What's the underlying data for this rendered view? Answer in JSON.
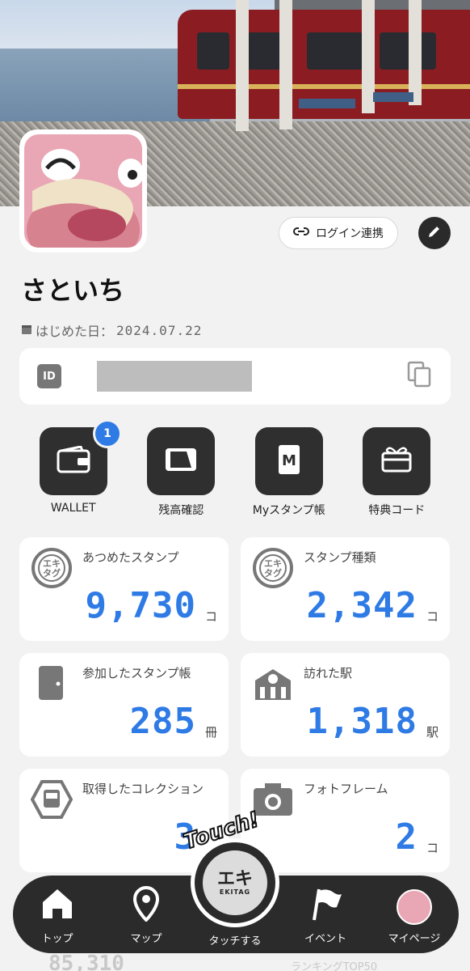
{
  "profile": {
    "name": "さといち",
    "start_date_label": "はじめた日：",
    "start_date": "2024.07.22",
    "id_badge": "ID",
    "login_link_label": "ログイン連携"
  },
  "quick_actions": [
    {
      "label": "WALLET",
      "badge": "1",
      "icon": "wallet-icon"
    },
    {
      "label": "残高確認",
      "icon": "card-icon"
    },
    {
      "label": "Myスタンプ帳",
      "icon": "stamp-book-icon"
    },
    {
      "label": "特典コード",
      "icon": "gift-icon"
    }
  ],
  "stats": [
    {
      "label": "あつめたスタンプ",
      "value": "9,730",
      "unit": "コ",
      "icon": "ekitag-stamp-icon"
    },
    {
      "label": "スタンプ種類",
      "value": "2,342",
      "unit": "コ",
      "icon": "ekitag-stamp-icon"
    },
    {
      "label": "参加したスタンプ帳",
      "value": "285",
      "unit": "冊",
      "icon": "book-icon"
    },
    {
      "label": "訪れた駅",
      "value": "1,318",
      "unit": "駅",
      "icon": "station-icon"
    },
    {
      "label": "取得したコレクション",
      "value": "3",
      "unit": "",
      "icon": "train-hexagon-icon"
    },
    {
      "label": "フォトフレーム",
      "value": "2",
      "unit": "コ",
      "icon": "camera-icon"
    }
  ],
  "peek": {
    "value": "85,310",
    "label": "ランキングTOP50"
  },
  "nav": {
    "items": [
      {
        "label": "トップ",
        "icon": "home-icon"
      },
      {
        "label": "マップ",
        "icon": "map-pin-icon"
      },
      {
        "label": "タッチする",
        "icon": "ekitag-touch-icon"
      },
      {
        "label": "イベント",
        "icon": "flag-icon"
      },
      {
        "label": "マイページ",
        "icon": "avatar-icon"
      }
    ],
    "touch_word": "Touch!",
    "center_logo_top": "エキ",
    "center_logo_bottom": "EKITAG"
  },
  "colors": {
    "accent": "#2f7be6",
    "dark": "#2b2b2b",
    "background": "#f2f2f2"
  }
}
